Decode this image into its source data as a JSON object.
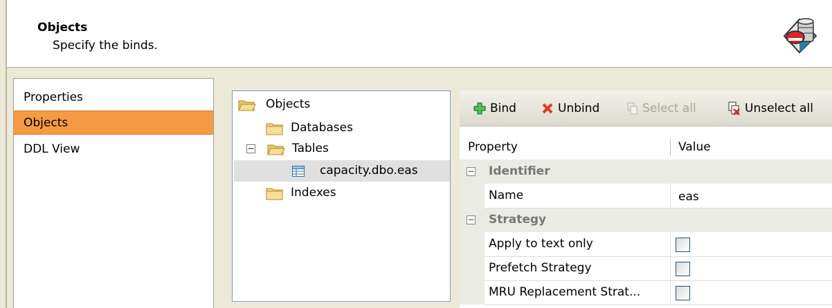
{
  "header": {
    "title": "Objects",
    "subtitle": "Specify the binds.",
    "icon": "database-wizard-icon"
  },
  "nav": {
    "items": [
      {
        "label": "Properties",
        "selected": false
      },
      {
        "label": "Objects",
        "selected": true
      },
      {
        "label": "DDL View",
        "selected": false
      }
    ],
    "selected_color": "#f79a44"
  },
  "tree": {
    "root": "Objects",
    "databases": "Databases",
    "tables": "Tables",
    "table_item": "capacity.dbo.eas",
    "indexes": "Indexes"
  },
  "toolbar": {
    "bind": "Bind",
    "unbind": "Unbind",
    "select_all": "Select all",
    "unselect_all": "Unselect all"
  },
  "grid": {
    "col_property": "Property",
    "col_value": "Value",
    "group_identifier": "Identifier",
    "name_label": "Name",
    "name_value": "eas",
    "group_strategy": "Strategy",
    "apply_text_only": "Apply to text only",
    "prefetch_strategy": "Prefetch Strategy",
    "mru_replacement": "MRU Replacement Strat..."
  }
}
